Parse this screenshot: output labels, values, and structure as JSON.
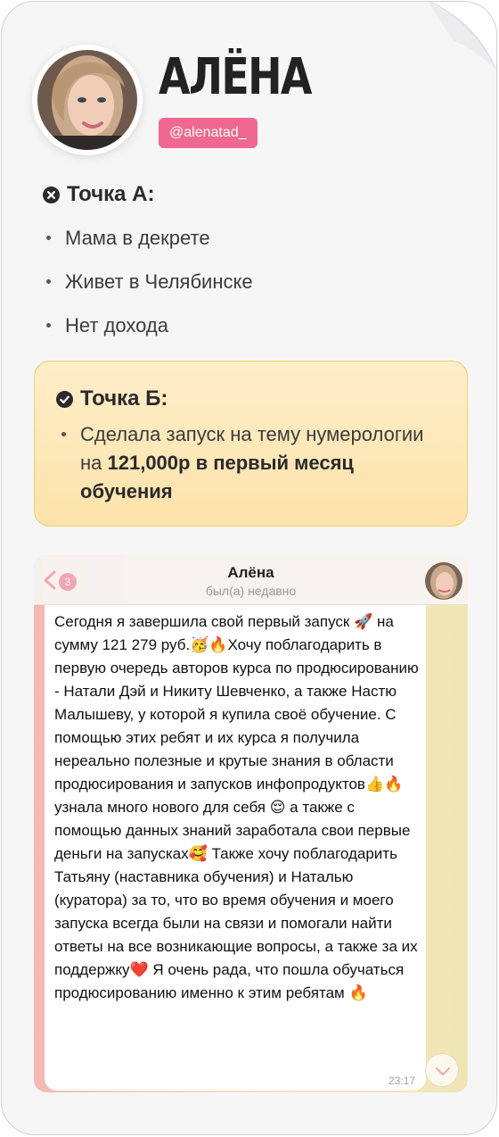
{
  "profile": {
    "name": "АЛЁНА",
    "handle": "@alenatad_"
  },
  "point_a": {
    "title": "Точка А:",
    "items": [
      "Мама в декрете",
      "Живет в Челябинске",
      "Нет дохода"
    ]
  },
  "point_b": {
    "title": "Точка Б:",
    "text_before": "Сделала запуск на тему нумерологии на ",
    "text_bold": "121,000р в первый месяц обучения"
  },
  "chat": {
    "unread_count": "3",
    "contact_name": "Алёна",
    "status": "был(а) недавно",
    "message": "Сегодня я завершила свой первый запуск 🚀 на сумму 121 279 руб.🥳🔥Хочу поблагодарить в первую очередь авторов курса по продюсированию - Натали Дэй и Никиту Шевченко, а также Настю Малышеву, у которой я купила своё обучение. С помощью этих ребят и их курса я получила нереально полезные и крутые знания в области продюсирования и запусков инфопродуктов👍🔥узнала много нового для себя 😌 а также с помощью данных знаний заработала свои первые деньги на запусках🥰 Также хочу поблагодарить Татьяну (наставника обучения) и Наталью (куратора) за то, что во время обучения и моего запуска всегда были на связи и помогали найти ответы на все возникающие вопросы, а также за их поддержку❤️ Я очень рада, что пошла обучаться продюсированию именно к этим ребятам 🔥",
    "time": "23:17"
  },
  "colors": {
    "handle_bg": "#f0688f",
    "point_b_bg": "#fde7b5",
    "point_b_border": "#efcf6e",
    "card_bg": "#f6f6f7"
  },
  "icons": [
    "x-circle-icon",
    "check-circle-icon",
    "back-chevron-icon",
    "scroll-down-icon"
  ]
}
